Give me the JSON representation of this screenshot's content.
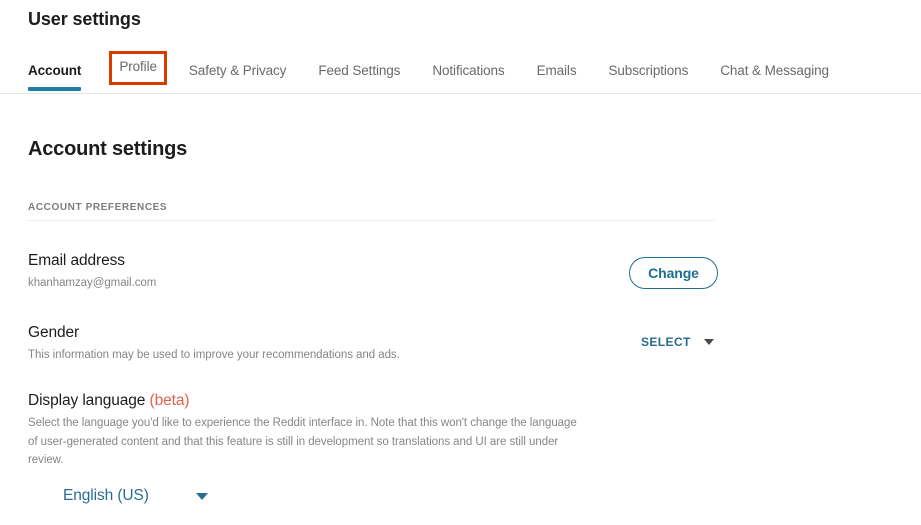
{
  "header": {
    "title": "User settings"
  },
  "tabs": [
    {
      "label": "Account",
      "state": "active"
    },
    {
      "label": "Profile",
      "state": "highlighted"
    },
    {
      "label": "Safety & Privacy",
      "state": "normal"
    },
    {
      "label": "Feed Settings",
      "state": "normal"
    },
    {
      "label": "Notifications",
      "state": "normal"
    },
    {
      "label": "Emails",
      "state": "normal"
    },
    {
      "label": "Subscriptions",
      "state": "normal"
    },
    {
      "label": "Chat & Messaging",
      "state": "normal"
    }
  ],
  "main": {
    "section_title": "Account settings",
    "preferences_label": "ACCOUNT PREFERENCES",
    "email": {
      "title": "Email address",
      "value": "khanhamzay@gmail.com",
      "button_label": "Change"
    },
    "gender": {
      "title": "Gender",
      "description": "This information may be used to improve your recommendations and ads.",
      "select_label": "SELECT",
      "caret_icon": "chevron-down-icon"
    },
    "display_language": {
      "title": "Display language",
      "beta_tag": "(beta)",
      "description": "Select the language you'd like to experience the Reddit interface in. Note that this won't change the language of user-generated content and that this feature is still in development so translations and UI are still under review.",
      "selected_value": "English (US)",
      "caret_icon": "chevron-down-icon"
    }
  },
  "colors": {
    "accent_blue": "#1f7ba8",
    "link_blue": "#2a6b96",
    "highlight_red": "#d93a00",
    "beta_red": "#e06250",
    "text_primary": "#1c1c1c",
    "text_muted": "#868686"
  }
}
